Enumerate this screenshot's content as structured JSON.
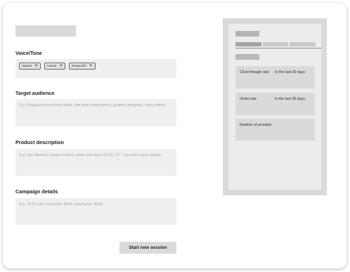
{
  "form": {
    "voice_tone": {
      "label": "Voice/Tone",
      "tags": [
        "Upbeat",
        "Casual",
        "Respectful"
      ],
      "remove_glyph": "✕"
    },
    "target_audience": {
      "label": "Target audience",
      "placeholder": "E.g. Singaporean working adults, first-time homeowners, graphic designers, video editors"
    },
    "product_description": {
      "label": "Product description",
      "placeholder": "E.g. Styx Monitor, comes in black, white and silver, OLED, 27\", accurate colour display"
    },
    "campaign_details": {
      "label": "Campaign details",
      "placeholder": "E.g. 10.10 sale, new price: $439, usual price: $599"
    },
    "start_button_label": "Start new session"
  },
  "stats_panel": {
    "tab_colors": [
      "#a3a3a3",
      "#c9c9c9",
      "#c9c9c9"
    ],
    "cards": [
      {
        "label": "Click-through rate",
        "period": "In the last 30 days"
      },
      {
        "label": "Order rate",
        "period": "In the last 30 days"
      },
      {
        "label": "Number of prompts",
        "period": ""
      }
    ]
  }
}
